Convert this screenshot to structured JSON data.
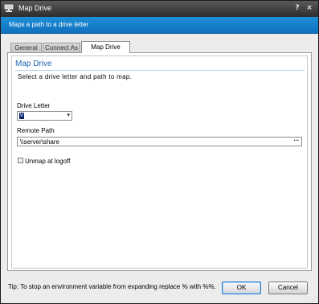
{
  "window": {
    "title": "Map Drive",
    "help_glyph": "?",
    "close_glyph": "×",
    "icon": "network-drive-icon"
  },
  "banner": {
    "text": "Maps a path to a drive letter",
    "color": "#1d8fd8"
  },
  "tabs": [
    {
      "label": "General",
      "active": false
    },
    {
      "label": "Connect As",
      "active": false
    },
    {
      "label": "Map Drive",
      "active": true
    }
  ],
  "group": {
    "title": "Map Drive",
    "subtitle": "Select a drive letter and path to map.",
    "title_color": "#1d66b0"
  },
  "drive_letter": {
    "label": "Drive Letter",
    "value": "V",
    "arrow": "▾"
  },
  "remote_path": {
    "label": "Remote Path",
    "value": "\\\\server\\share",
    "browse": "···"
  },
  "unmap": {
    "label": "Unmap at logoff",
    "checked": false
  },
  "footer": {
    "tip": "Tip: To stop an environment variable from expanding replace % with %%.",
    "ok_label": "OK",
    "cancel_label": "Cancel"
  }
}
